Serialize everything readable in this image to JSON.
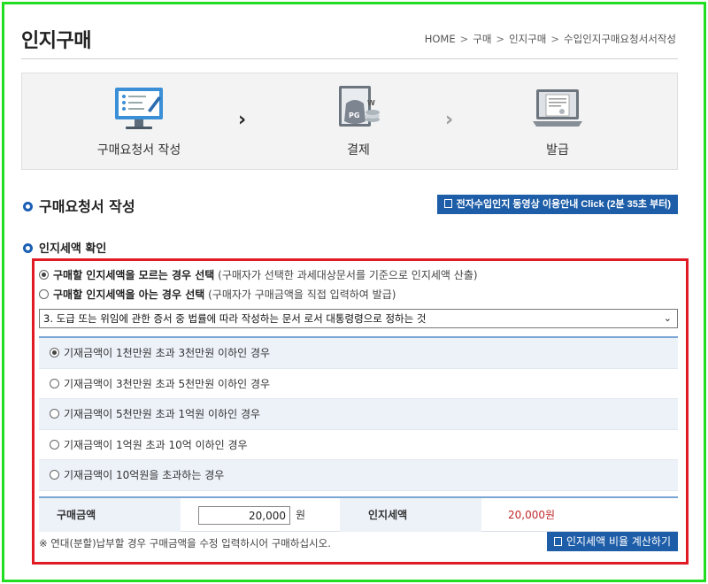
{
  "header": {
    "title": "인지구매",
    "breadcrumb": [
      "HOME",
      "구매",
      "인지구매",
      "수입인지구매요청서서작성"
    ],
    "breadcrumb_sep": ">"
  },
  "steps": {
    "items": [
      {
        "label": "구매요청서 작성",
        "icon": "monitor-form-icon"
      },
      {
        "label": "결제",
        "icon": "payment-bag-icon"
      },
      {
        "label": "발급",
        "icon": "laptop-document-icon"
      }
    ],
    "arrow": "›"
  },
  "section": {
    "title": "구매요청서 작성",
    "video_button": "전자수입인지 동영상 이용안내 Click (2분 35초 부터)"
  },
  "stamp_tax": {
    "title": "인지세액 확인",
    "modes": [
      {
        "label": "구매할 인지세액을 모르는 경우 선택",
        "note": "(구매자가 선택한 과세대상문서를 기준으로 인지세액 산출)",
        "selected": true
      },
      {
        "label": "구매할 인지세액을 아는 경우 선택",
        "note": "(구매자가 구매금액을 직접 입력하여 발급)",
        "selected": false
      }
    ],
    "document_type": "3. 도급 또는 위임에 관한 증서 중 법률에 따라 작성하는 문서 로서 대통령령으로 정하는 것",
    "options": [
      {
        "label": "기재금액이 1천만원 초과 3천만원 이하인 경우",
        "selected": true
      },
      {
        "label": "기재금액이 3천만원 초과 5천만원 이하인 경우",
        "selected": false
      },
      {
        "label": "기재금액이 5천만원 초과 1억원 이하인 경우",
        "selected": false
      },
      {
        "label": "기재금액이 1억원 초과 10억 이하인 경우",
        "selected": false
      },
      {
        "label": "기재금액이 10억원을 초과하는 경우",
        "selected": false
      }
    ],
    "amount_label": "구매금액",
    "amount_value": "20,000",
    "amount_unit": "원",
    "tax_label": "인지세액",
    "tax_value": "20,000원",
    "note": "※ 연대(분할)납부할 경우 구매금액을 수정 입력하시어 구매하십시오.",
    "calc_button": "인지세액 비율 계산하기"
  },
  "colors": {
    "accent": "#1e5ea8",
    "highlight_frame": "#22dd22",
    "focus_box": "#e01b24",
    "tax_value": "#c0282b"
  }
}
